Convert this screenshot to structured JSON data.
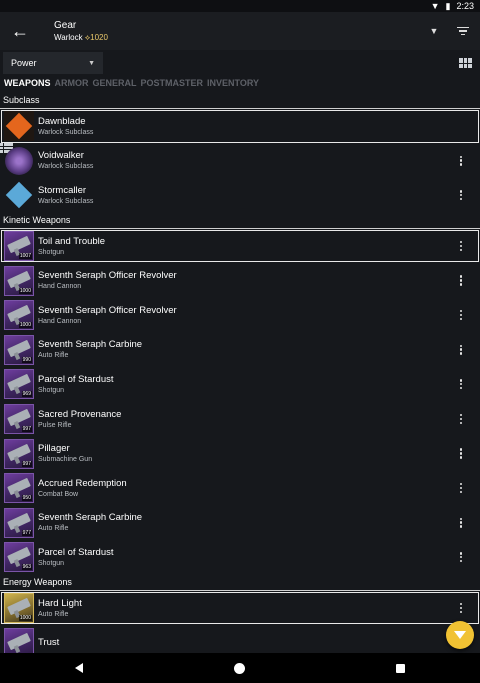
{
  "status": {
    "time": "2:23"
  },
  "appbar": {
    "title": "Gear",
    "character": "Warlock",
    "power": "⟡1020"
  },
  "sort": {
    "selected": "Power"
  },
  "tabs": [
    "WEAPONS",
    "ARMOR",
    "GENERAL",
    "POSTMASTER",
    "INVENTORY"
  ],
  "sections": {
    "subclass": "Subclass",
    "kinetic": "Kinetic Weapons",
    "energy": "Energy Weapons"
  },
  "subclasses": [
    {
      "name": "Dawnblade",
      "type": "Warlock Subclass"
    },
    {
      "name": "Voidwalker",
      "type": "Warlock Subclass"
    },
    {
      "name": "Stormcaller",
      "type": "Warlock Subclass"
    }
  ],
  "kinetic": [
    {
      "name": "Toil and Trouble",
      "type": "Shotgun",
      "power": "1007"
    },
    {
      "name": "Seventh Seraph Officer Revolver",
      "type": "Hand Cannon",
      "power": "1000"
    },
    {
      "name": "Seventh Seraph Officer Revolver",
      "type": "Hand Cannon",
      "power": "1000"
    },
    {
      "name": "Seventh Seraph Carbine",
      "type": "Auto Rifle",
      "power": "990"
    },
    {
      "name": "Parcel of Stardust",
      "type": "Shotgun",
      "power": "969"
    },
    {
      "name": "Sacred Provenance",
      "type": "Pulse Rifle",
      "power": "997"
    },
    {
      "name": "Pillager",
      "type": "Submachine Gun",
      "power": "997"
    },
    {
      "name": "Accrued Redemption",
      "type": "Combat Bow",
      "power": "950"
    },
    {
      "name": "Seventh Seraph Carbine",
      "type": "Auto Rifle",
      "power": "977"
    },
    {
      "name": "Parcel of Stardust",
      "type": "Shotgun",
      "power": "963"
    }
  ],
  "energy": [
    {
      "name": "Hard Light",
      "type": "Auto Rifle",
      "power": "1000"
    },
    {
      "name": "Trust",
      "type": "",
      "power": ""
    }
  ]
}
